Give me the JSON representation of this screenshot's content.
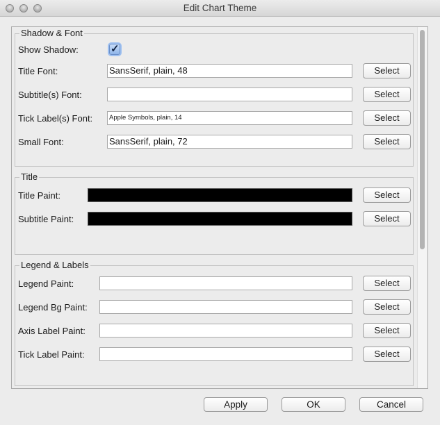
{
  "window": {
    "title": "Edit Chart Theme"
  },
  "shadow_font": {
    "title": "Shadow & Font",
    "show_shadow_label": "Show Shadow:",
    "show_shadow_checked": true,
    "title_font_label": "Title Font:",
    "title_font_value": "SansSerif, plain, 48",
    "subtitle_font_label": "Subtitle(s) Font:",
    "subtitle_font_value": "",
    "tick_label_font_label": "Tick Label(s) Font:",
    "tick_label_font_value": "Apple Symbols, plain, 14",
    "small_font_label": "Small Font:",
    "small_font_value": "SansSerif, plain, 72"
  },
  "title_section": {
    "title": "Title",
    "title_paint_label": "Title Paint:",
    "title_paint_color": "#000000",
    "subtitle_paint_label": "Subtitle Paint:",
    "subtitle_paint_color": "#000000"
  },
  "legend_labels": {
    "title": "Legend & Labels",
    "legend_paint_label": "Legend Paint:",
    "legend_bg_paint_label": "Legend Bg Paint:",
    "axis_label_paint_label": "Axis Label Paint:",
    "tick_label_paint_label": "Tick Label Paint:"
  },
  "select_label": "Select",
  "footer": {
    "apply": "Apply",
    "ok": "OK",
    "cancel": "Cancel"
  }
}
